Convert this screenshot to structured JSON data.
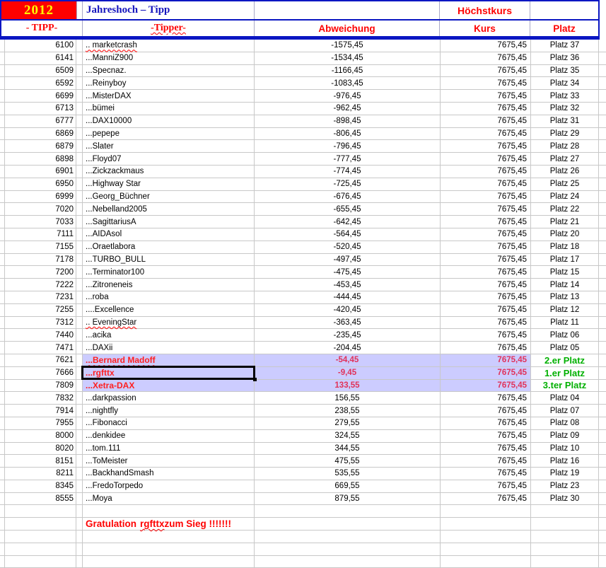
{
  "header": {
    "year": "2012",
    "title": "Jahreshoch – Tipp",
    "hoechstkurs_label": "Höchstkurs",
    "col_tipp": "- TIPP-",
    "col_tipper": "-Tipper-",
    "col_abweichung": "Abweichung",
    "col_kurs": "Kurs",
    "col_platz": "Platz"
  },
  "colors": {
    "header_border_blue": "#0a16c2",
    "year_bg_red": "#fe0000",
    "year_text_yellow": "#ffff00",
    "title_blue": "#1414bd",
    "header_text_red": "#fe0202",
    "highlight_lavender": "#ccccff",
    "highlight_name_red": "#ff1f1f",
    "highlight_value_rose": "#e0325a",
    "winner_green": "#00b000",
    "gridline_gray": "#c8c8c8"
  },
  "table": {
    "rows": [
      {
        "tipp": "6100",
        "tipper": ".. marketcrash",
        "abweichung": "-1575,45",
        "kurs": "7675,45",
        "platz": "Platz 37",
        "highlighted": false,
        "selected": false,
        "misspelled": true
      },
      {
        "tipp": "6141",
        "tipper": "...ManniZ900",
        "abweichung": "-1534,45",
        "kurs": "7675,45",
        "platz": "Platz 36",
        "highlighted": false,
        "selected": false,
        "misspelled": false
      },
      {
        "tipp": "6509",
        "tipper": "...Specnaz.",
        "abweichung": "-1166,45",
        "kurs": "7675,45",
        "platz": "Platz 35",
        "highlighted": false,
        "selected": false,
        "misspelled": false
      },
      {
        "tipp": "6592",
        "tipper": "...Reinyboy",
        "abweichung": "-1083,45",
        "kurs": "7675,45",
        "platz": "Platz 34",
        "highlighted": false,
        "selected": false,
        "misspelled": false
      },
      {
        "tipp": "6699",
        "tipper": "...MisterDAX",
        "abweichung": "-976,45",
        "kurs": "7675,45",
        "platz": "Platz 33",
        "highlighted": false,
        "selected": false,
        "misspelled": false
      },
      {
        "tipp": "6713",
        "tipper": "...bümei",
        "abweichung": "-962,45",
        "kurs": "7675,45",
        "platz": "Platz 32",
        "highlighted": false,
        "selected": false,
        "misspelled": false
      },
      {
        "tipp": "6777",
        "tipper": "...DAX10000",
        "abweichung": "-898,45",
        "kurs": "7675,45",
        "platz": "Platz 31",
        "highlighted": false,
        "selected": false,
        "misspelled": false
      },
      {
        "tipp": "6869",
        "tipper": "...pepepe",
        "abweichung": "-806,45",
        "kurs": "7675,45",
        "platz": "Platz 29",
        "highlighted": false,
        "selected": false,
        "misspelled": false
      },
      {
        "tipp": "6879",
        "tipper": "...Slater",
        "abweichung": "-796,45",
        "kurs": "7675,45",
        "platz": "Platz 28",
        "highlighted": false,
        "selected": false,
        "misspelled": false
      },
      {
        "tipp": "6898",
        "tipper": "...Floyd07",
        "abweichung": "-777,45",
        "kurs": "7675,45",
        "platz": "Platz 27",
        "highlighted": false,
        "selected": false,
        "misspelled": false
      },
      {
        "tipp": "6901",
        "tipper": "...Zickzackmaus",
        "abweichung": "-774,45",
        "kurs": "7675,45",
        "platz": "Platz 26",
        "highlighted": false,
        "selected": false,
        "misspelled": false
      },
      {
        "tipp": "6950",
        "tipper": "...Highway Star",
        "abweichung": "-725,45",
        "kurs": "7675,45",
        "platz": "Platz 25",
        "highlighted": false,
        "selected": false,
        "misspelled": false
      },
      {
        "tipp": "6999",
        "tipper": "...Georg_Büchner",
        "abweichung": "-676,45",
        "kurs": "7675,45",
        "platz": "Platz 24",
        "highlighted": false,
        "selected": false,
        "misspelled": false
      },
      {
        "tipp": "7020",
        "tipper": "...Nebelland2005",
        "abweichung": "-655,45",
        "kurs": "7675,45",
        "platz": "Platz 22",
        "highlighted": false,
        "selected": false,
        "misspelled": false
      },
      {
        "tipp": "7033",
        "tipper": "...SagittariusA",
        "abweichung": "-642,45",
        "kurs": "7675,45",
        "platz": "Platz 21",
        "highlighted": false,
        "selected": false,
        "misspelled": false
      },
      {
        "tipp": "7111",
        "tipper": "...AIDAsol",
        "abweichung": "-564,45",
        "kurs": "7675,45",
        "platz": "Platz 20",
        "highlighted": false,
        "selected": false,
        "misspelled": false
      },
      {
        "tipp": "7155",
        "tipper": "...Oraetlabora",
        "abweichung": "-520,45",
        "kurs": "7675,45",
        "platz": "Platz 18",
        "highlighted": false,
        "selected": false,
        "misspelled": false
      },
      {
        "tipp": "7178",
        "tipper": "...TURBO_BULL",
        "abweichung": "-497,45",
        "kurs": "7675,45",
        "platz": "Platz 17",
        "highlighted": false,
        "selected": false,
        "misspelled": false
      },
      {
        "tipp": "7200",
        "tipper": "...Terminator100",
        "abweichung": "-475,45",
        "kurs": "7675,45",
        "platz": "Platz 15",
        "highlighted": false,
        "selected": false,
        "misspelled": false
      },
      {
        "tipp": "7222",
        "tipper": "...Zitroneneis",
        "abweichung": "-453,45",
        "kurs": "7675,45",
        "platz": "Platz 14",
        "highlighted": false,
        "selected": false,
        "misspelled": false
      },
      {
        "tipp": "7231",
        "tipper": "...roba",
        "abweichung": "-444,45",
        "kurs": "7675,45",
        "platz": "Platz 13",
        "highlighted": false,
        "selected": false,
        "misspelled": false
      },
      {
        "tipp": "7255",
        "tipper": "....Excellence",
        "abweichung": "-420,45",
        "kurs": "7675,45",
        "platz": "Platz 12",
        "highlighted": false,
        "selected": false,
        "misspelled": false
      },
      {
        "tipp": "7312",
        "tipper": ".. EveningStar",
        "abweichung": "-363,45",
        "kurs": "7675,45",
        "platz": "Platz 11",
        "highlighted": false,
        "selected": false,
        "misspelled": true
      },
      {
        "tipp": "7440",
        "tipper": "...acika",
        "abweichung": "-235,45",
        "kurs": "7675,45",
        "platz": "Platz 06",
        "highlighted": false,
        "selected": false,
        "misspelled": false
      },
      {
        "tipp": "7471",
        "tipper": "...DAXii",
        "abweichung": "-204,45",
        "kurs": "7675,45",
        "platz": "Platz 05",
        "highlighted": false,
        "selected": false,
        "misspelled": false
      },
      {
        "tipp": "7621",
        "tipper": "...Bernard Madoff",
        "abweichung": "-54,45",
        "kurs": "7675,45",
        "platz": "2.er Platz",
        "highlighted": true,
        "selected": false,
        "misspelled": true
      },
      {
        "tipp": "7666",
        "tipper": "...rgfttx",
        "abweichung": "-9,45",
        "kurs": "7675,45",
        "platz": "1.er Platz",
        "highlighted": true,
        "selected": true,
        "misspelled": false
      },
      {
        "tipp": "7809",
        "tipper": "...Xetra-DAX",
        "abweichung": "133,55",
        "kurs": "7675,45",
        "platz": "3.ter Platz",
        "highlighted": true,
        "selected": false,
        "misspelled": false
      },
      {
        "tipp": "7832",
        "tipper": "...darkpassion",
        "abweichung": "156,55",
        "kurs": "7675,45",
        "platz": "Platz 04",
        "highlighted": false,
        "selected": false,
        "misspelled": false
      },
      {
        "tipp": "7914",
        "tipper": "...nightfly",
        "abweichung": "238,55",
        "kurs": "7675,45",
        "platz": "Platz 07",
        "highlighted": false,
        "selected": false,
        "misspelled": false
      },
      {
        "tipp": "7955",
        "tipper": "...Fibonacci",
        "abweichung": "279,55",
        "kurs": "7675,45",
        "platz": "Platz 08",
        "highlighted": false,
        "selected": false,
        "misspelled": false
      },
      {
        "tipp": "8000",
        "tipper": "...denkidee",
        "abweichung": "324,55",
        "kurs": "7675,45",
        "platz": "Platz 09",
        "highlighted": false,
        "selected": false,
        "misspelled": false
      },
      {
        "tipp": "8020",
        "tipper": "...tom.111",
        "abweichung": "344,55",
        "kurs": "7675,45",
        "platz": "Platz 10",
        "highlighted": false,
        "selected": false,
        "misspelled": false
      },
      {
        "tipp": "8151",
        "tipper": "...ToMeister",
        "abweichung": "475,55",
        "kurs": "7675,45",
        "platz": "Platz 16",
        "highlighted": false,
        "selected": false,
        "misspelled": false
      },
      {
        "tipp": "8211",
        "tipper": "...BackhandSmash",
        "abweichung": "535,55",
        "kurs": "7675,45",
        "platz": "Platz 19",
        "highlighted": false,
        "selected": false,
        "misspelled": false
      },
      {
        "tipp": "8345",
        "tipper": "...FredoTorpedo",
        "abweichung": "669,55",
        "kurs": "7675,45",
        "platz": "Platz 23",
        "highlighted": false,
        "selected": false,
        "misspelled": false
      },
      {
        "tipp": "8555",
        "tipper": "...Moya",
        "abweichung": "879,55",
        "kurs": "7675,45",
        "platz": "Platz 30",
        "highlighted": false,
        "selected": false,
        "misspelled": false
      }
    ]
  },
  "footer": {
    "gratulation_prefix": "Gratulation",
    "gratulation_name": "rgfttx",
    "gratulation_suffix": " zum Sieg !!!!!!!"
  }
}
